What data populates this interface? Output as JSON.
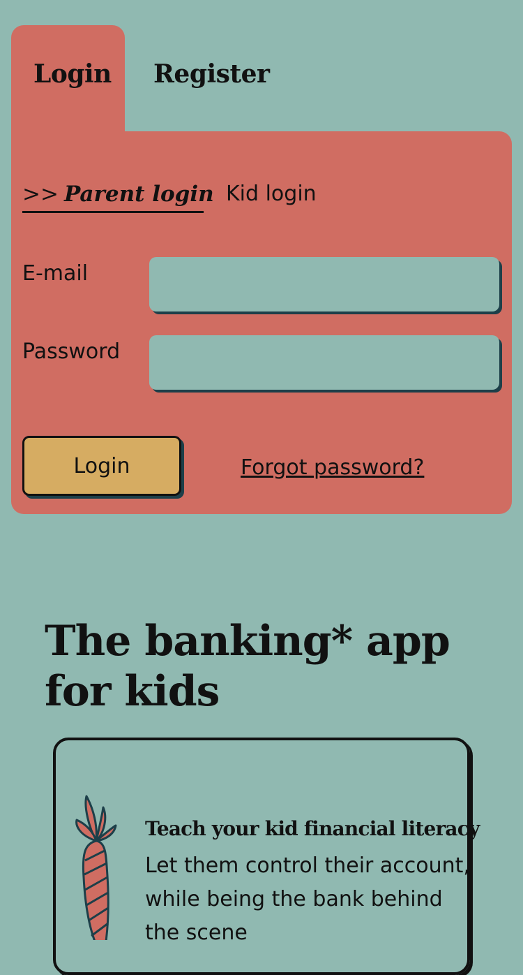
{
  "tabs": {
    "login": "Login",
    "register": "Register"
  },
  "login_card": {
    "subtabs": {
      "parent_arrows": ">>",
      "parent": "Parent login",
      "kid": "Kid login"
    },
    "fields": {
      "email_label": "E-mail",
      "email_value": "",
      "password_label": "Password",
      "password_value": ""
    },
    "login_button": "Login",
    "forgot_link": "Forgot password?"
  },
  "hero": {
    "title": "The banking* app for kids",
    "feature": {
      "icon": "carrot-icon",
      "heading": "Teach your kid financial literacy",
      "text": "Let them control their account, while being the bank behind the scene"
    }
  },
  "colors": {
    "background": "#90b9b1",
    "card": "#d06d62",
    "button": "#d6ac62",
    "shadow": "#1d3f49"
  }
}
